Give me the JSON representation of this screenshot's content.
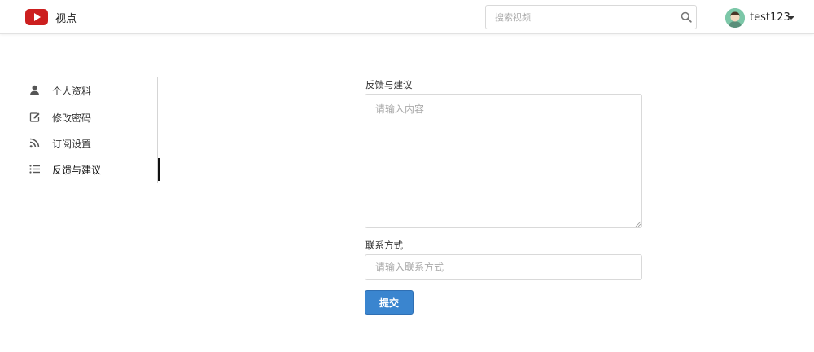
{
  "header": {
    "brand": "视点",
    "search_placeholder": "搜索视频",
    "username": "test123"
  },
  "sidebar": {
    "items": [
      {
        "label": "个人资料",
        "icon": "user-icon"
      },
      {
        "label": "修改密码",
        "icon": "edit-icon"
      },
      {
        "label": "订阅设置",
        "icon": "rss-icon"
      },
      {
        "label": "反馈与建议",
        "icon": "list-icon",
        "active": true
      }
    ]
  },
  "form": {
    "feedback_label": "反馈与建议",
    "feedback_placeholder": "请输入内容",
    "contact_label": "联系方式",
    "contact_placeholder": "请输入联系方式",
    "submit_label": "提交"
  },
  "colors": {
    "brand_red": "#cc1f1f",
    "primary_button": "#3a85cf",
    "avatar_bg": "#7cc7a8"
  }
}
